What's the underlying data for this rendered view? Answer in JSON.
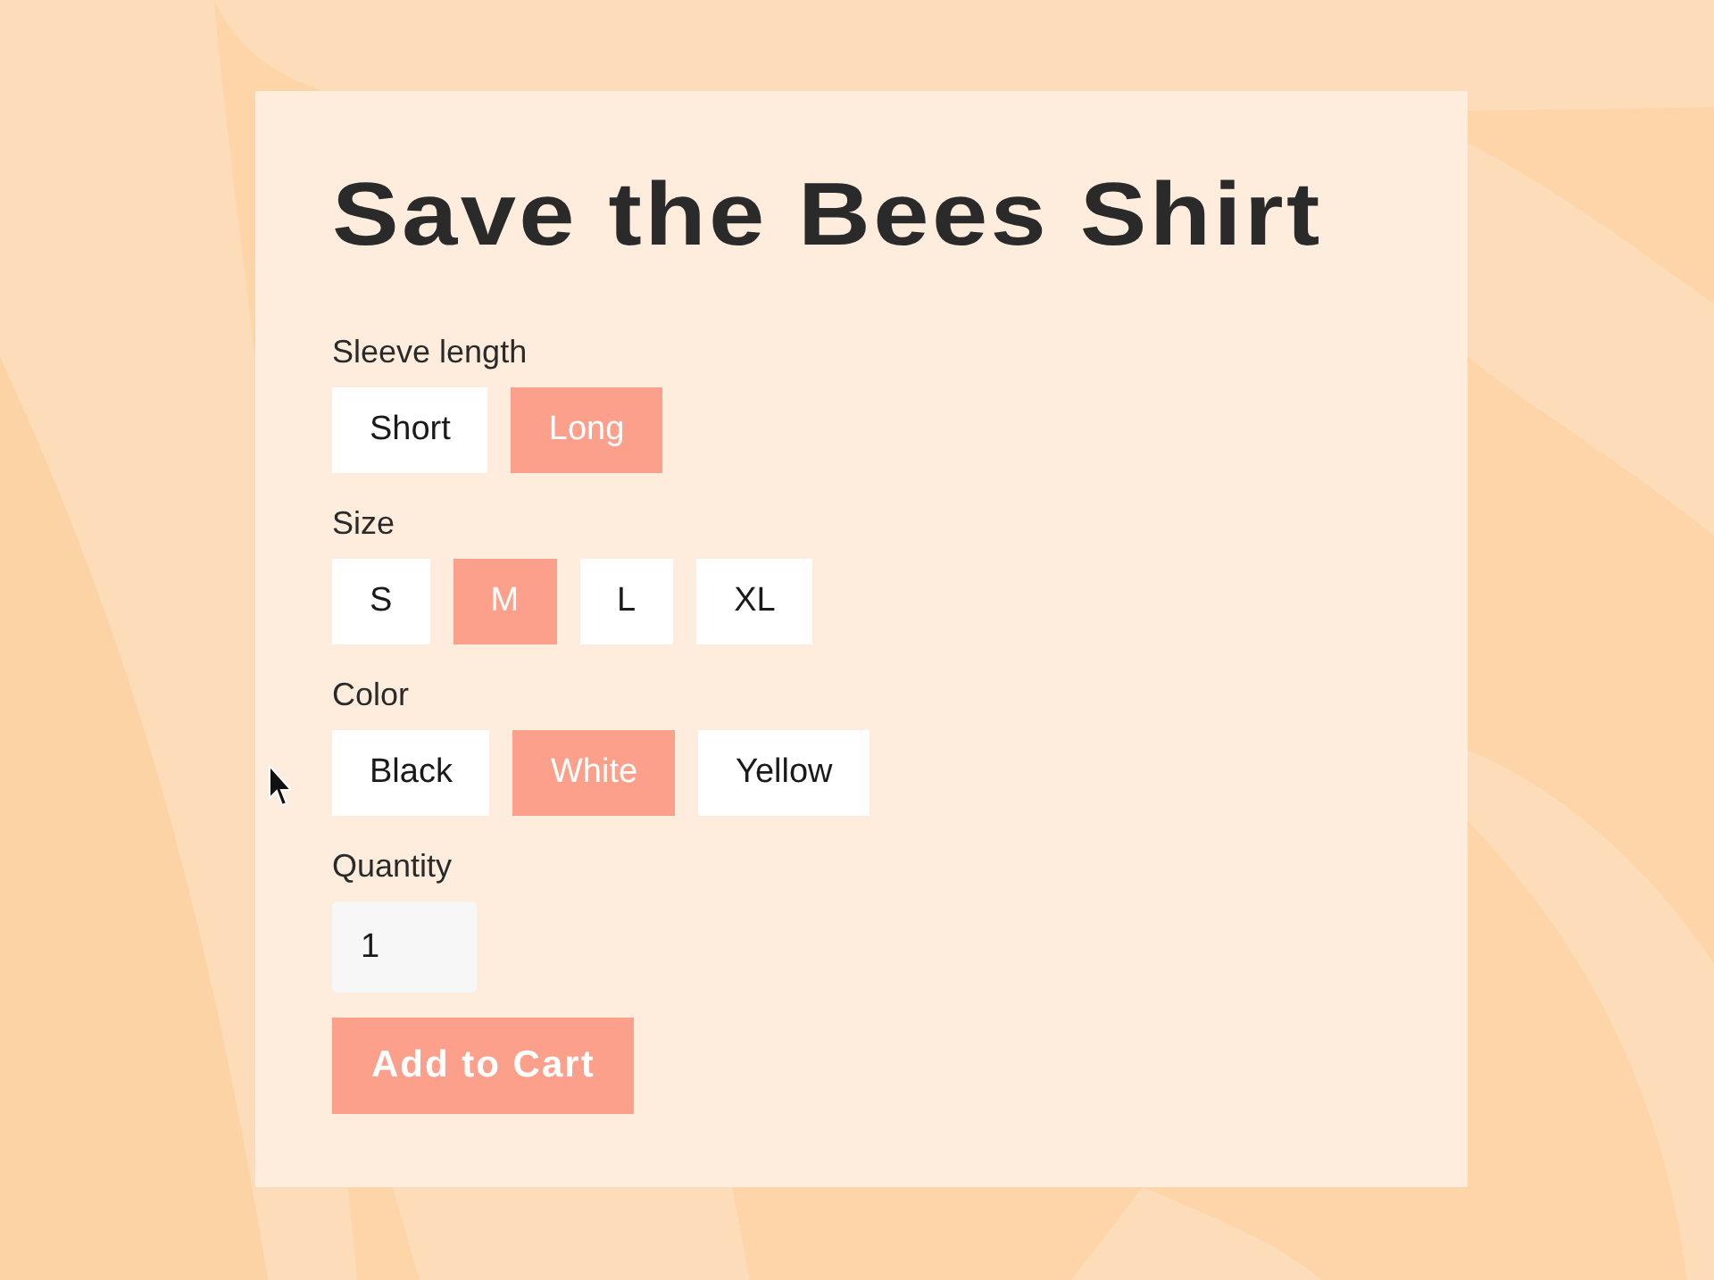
{
  "product": {
    "title": "Save the Bees Shirt"
  },
  "options": [
    {
      "label": "Sleeve length",
      "choices": [
        {
          "label": "Short",
          "selected": false
        },
        {
          "label": "Long",
          "selected": true
        }
      ]
    },
    {
      "label": "Size",
      "choices": [
        {
          "label": "S",
          "selected": false
        },
        {
          "label": "M",
          "selected": true
        },
        {
          "label": "L",
          "selected": false
        },
        {
          "label": "XL",
          "selected": false
        }
      ]
    },
    {
      "label": "Color",
      "choices": [
        {
          "label": "Black",
          "selected": false
        },
        {
          "label": "White",
          "selected": true
        },
        {
          "label": "Yellow",
          "selected": false
        }
      ]
    }
  ],
  "quantity": {
    "label": "Quantity",
    "value": "1"
  },
  "add_to_cart": {
    "label": "Add to Cart"
  }
}
